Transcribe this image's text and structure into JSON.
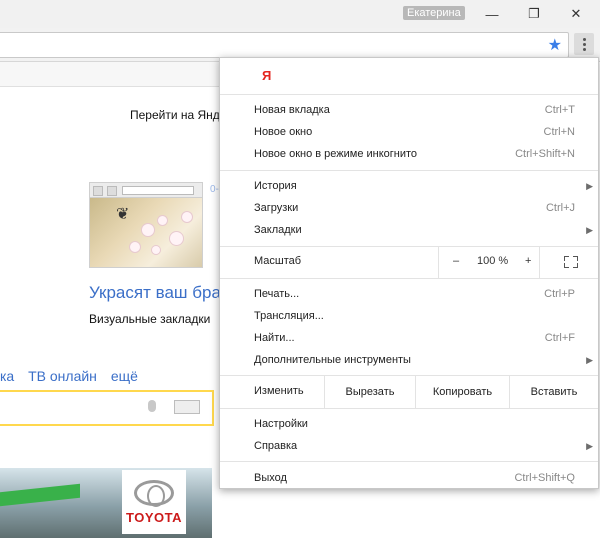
{
  "window": {
    "user_name": "Екатерина",
    "minimize_glyph": "—",
    "restore_glyph": "❐",
    "close_glyph": "✕"
  },
  "page": {
    "goto_text": "Перейти на Янд",
    "promo_title": "Украсят ваш бра",
    "promo_subtitle": "Визуальные закладки",
    "faint_number": "0-",
    "links": [
      "ка",
      "ТВ онлайн",
      "ещё"
    ],
    "ad_brand": "TOYOTA"
  },
  "menu": {
    "logo": "Я",
    "group1": [
      {
        "label": "Новая вкладка",
        "shortcut": "Ctrl+T"
      },
      {
        "label": "Новое окно",
        "shortcut": "Ctrl+N"
      },
      {
        "label": "Новое окно в режиме инкогнито",
        "shortcut": "Ctrl+Shift+N"
      }
    ],
    "group2": [
      {
        "label": "История",
        "shortcut": ""
      },
      {
        "label": "Загрузки",
        "shortcut": "Ctrl+J"
      },
      {
        "label": "Закладки",
        "shortcut": ""
      }
    ],
    "zoom": {
      "label": "Масштаб",
      "minus": "–",
      "value": "100 %",
      "plus": "+"
    },
    "group3": [
      {
        "label": "Печать...",
        "shortcut": "Ctrl+P"
      },
      {
        "label": "Трансляция...",
        "shortcut": ""
      },
      {
        "label": "Найти...",
        "shortcut": "Ctrl+F"
      },
      {
        "label": "Дополнительные инструменты",
        "shortcut": ""
      }
    ],
    "edit": {
      "label": "Изменить",
      "cut": "Вырезать",
      "copy": "Копировать",
      "paste": "Вставить"
    },
    "group4": [
      {
        "label": "Настройки",
        "shortcut": ""
      },
      {
        "label": "Справка",
        "shortcut": ""
      }
    ],
    "exit": {
      "label": "Выход",
      "shortcut": "Ctrl+Shift+Q"
    }
  }
}
